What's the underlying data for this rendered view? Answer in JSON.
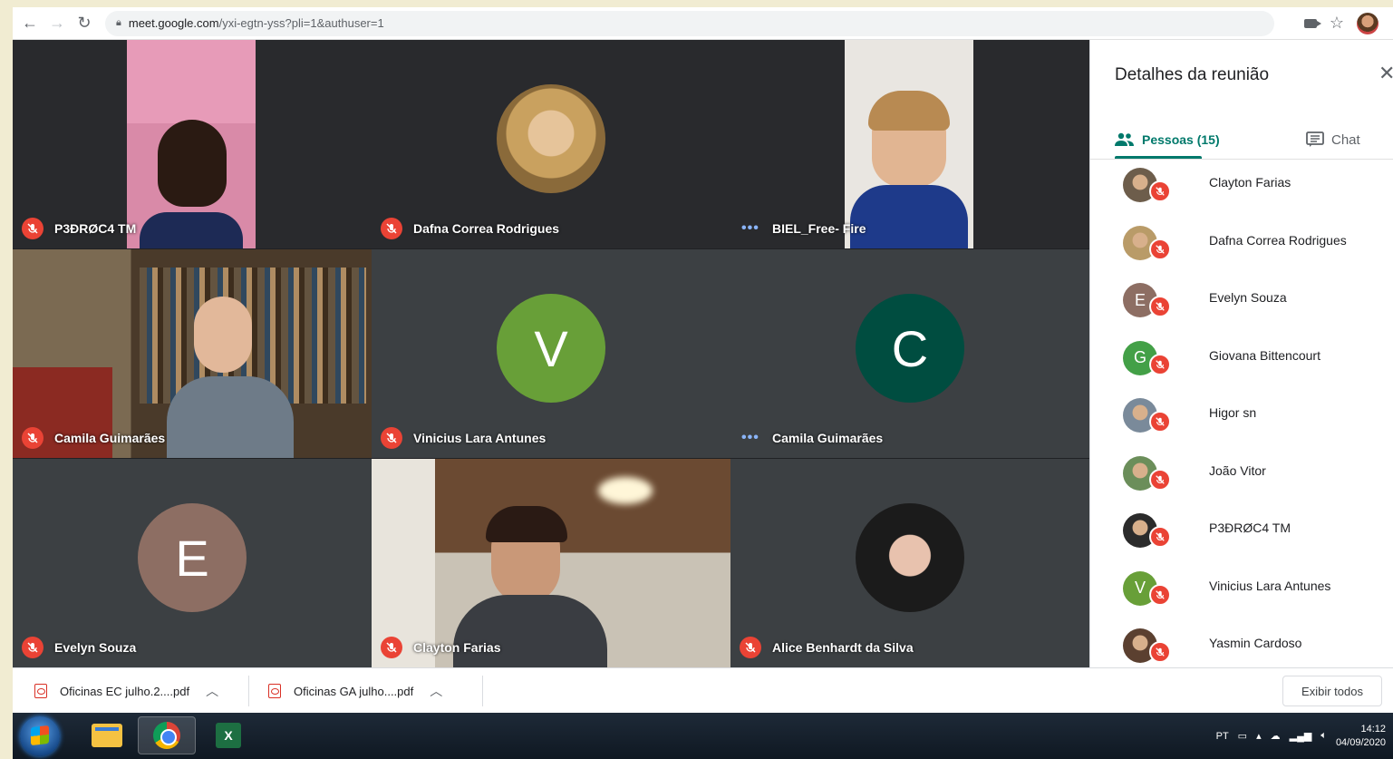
{
  "browser": {
    "url_host": "meet.google.com",
    "url_path": "/yxi-egtn-yss?pli=1&authuser=1"
  },
  "tiles": [
    {
      "name": "P3ÐRØC4 TM",
      "status": "muted",
      "kind": "video"
    },
    {
      "name": "Dafna Correa Rodrigues",
      "status": "muted",
      "kind": "photo"
    },
    {
      "name": "BIEL_Free- Fire",
      "status": "speaking",
      "kind": "video"
    },
    {
      "name": "Camila Guimarães",
      "status": "muted",
      "kind": "video"
    },
    {
      "name": "Vinicius Lara Antunes",
      "status": "muted",
      "kind": "initial",
      "initial": "V",
      "color": "#689f38"
    },
    {
      "name": "Camila Guimarães",
      "status": "speaking",
      "kind": "initial",
      "initial": "C",
      "color": "#004d40"
    },
    {
      "name": "Evelyn Souza",
      "status": "muted",
      "kind": "initial",
      "initial": "E",
      "color": "#8d6e63"
    },
    {
      "name": "Clayton Farias",
      "status": "muted",
      "kind": "video"
    },
    {
      "name": "Alice Benhardt da Silva",
      "status": "muted",
      "kind": "photo"
    }
  ],
  "panel": {
    "title": "Detalhes da reunião",
    "tab_people": "Pessoas (15)",
    "tab_chat": "Chat"
  },
  "people": [
    {
      "name": "Clayton Farias",
      "avatar": "photo",
      "color": "#6d5d4b"
    },
    {
      "name": "Dafna Correa Rodrigues",
      "avatar": "photo",
      "color": "#b99b68"
    },
    {
      "name": "Evelyn Souza",
      "avatar": "initial",
      "initial": "E",
      "color": "#8d6e63"
    },
    {
      "name": "Giovana Bittencourt",
      "avatar": "initial",
      "initial": "G",
      "color": "#43a047"
    },
    {
      "name": "Higor sn",
      "avatar": "photo",
      "color": "#7a8a9a"
    },
    {
      "name": "João Vitor",
      "avatar": "photo",
      "color": "#6b8e5a"
    },
    {
      "name": "P3ÐRØC4 TM",
      "avatar": "photo",
      "color": "#2b2b2b"
    },
    {
      "name": "Vinicius Lara Antunes",
      "avatar": "initial",
      "initial": "V",
      "color": "#689f38"
    },
    {
      "name": "Yasmin Cardoso",
      "avatar": "photo",
      "color": "#5b4030"
    }
  ],
  "downloads": {
    "items": [
      "Oficinas EC julho.2....pdf",
      "Oficinas GA julho....pdf"
    ],
    "show_all": "Exibir todos"
  },
  "taskbar": {
    "language": "PT",
    "time": "14:12",
    "date": "04/09/2020"
  }
}
